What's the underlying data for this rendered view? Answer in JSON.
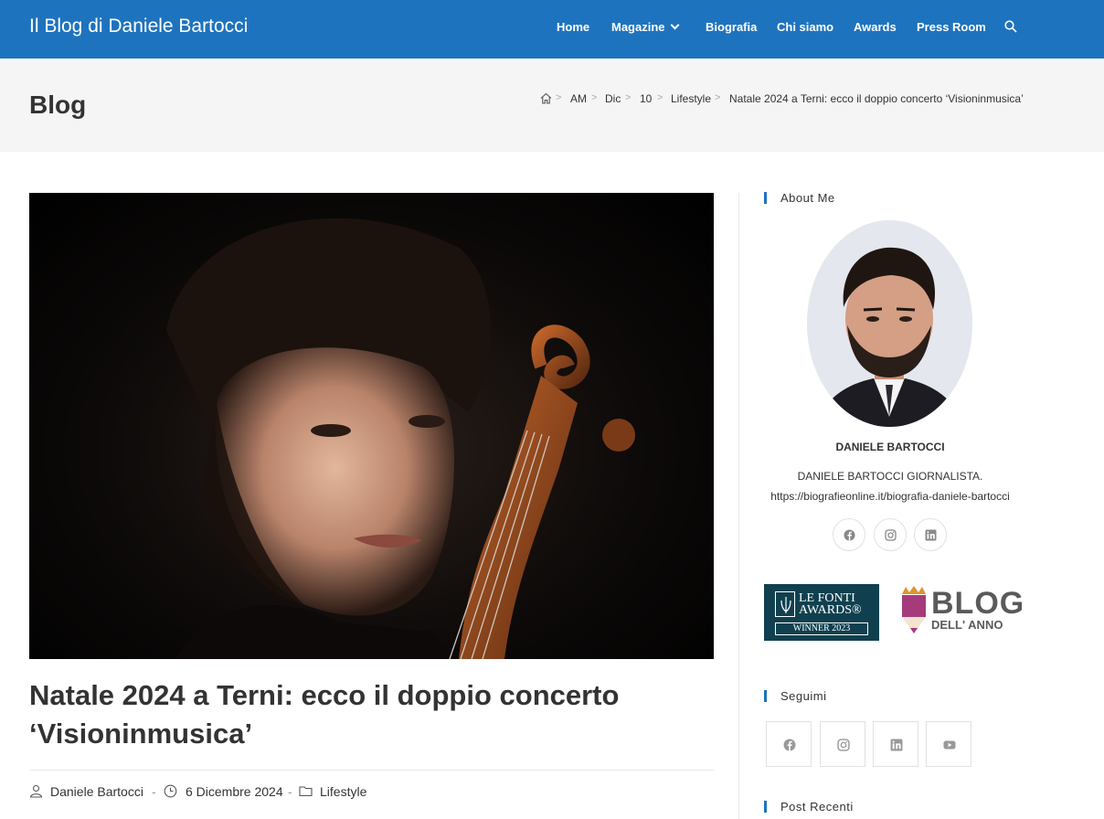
{
  "header": {
    "site_title": "Il Blog di Daniele Bartocci",
    "nav": [
      "Home",
      "Magazine",
      "Biografia",
      "Chi siamo",
      "Awards",
      "Press Room"
    ],
    "brand_color": "#1e73be"
  },
  "page_header": {
    "title": "Blog",
    "breadcrumb": [
      "AM",
      "Dic",
      "10",
      "Lifestyle",
      "Natale 2024 a Terni: ecco il doppio concerto ‘Visioninmusica’"
    ]
  },
  "post": {
    "title": "Natale 2024 a Terni: ecco il doppio concerto ‘Visioninmusica’",
    "author": "Daniele Bartocci",
    "date": "6 Dicembre 2024",
    "category": "Lifestyle",
    "separator": "-"
  },
  "sidebar": {
    "about_title": "About Me",
    "about_name": "DANIELE BARTOCCI",
    "about_desc_line1": "DANIELE BARTOCCI GIORNALISTA.",
    "about_desc_line2": "https://biografieonline.it/biografia-daniele-bartocci",
    "about_social_icons": [
      "facebook-icon",
      "instagram-icon",
      "linkedin-icon"
    ],
    "badge_fonti": {
      "line1": "LE FONTI",
      "line2": "AWARDS®",
      "line3": "WINNER 2023"
    },
    "badge_blog": {
      "word": "BLOG",
      "sub": "DELL' ANNO"
    },
    "follow_title": "Seguimi",
    "follow_icons": [
      "facebook-icon",
      "instagram-icon",
      "linkedin-icon",
      "youtube-icon"
    ],
    "recent_title": "Post Recenti"
  }
}
